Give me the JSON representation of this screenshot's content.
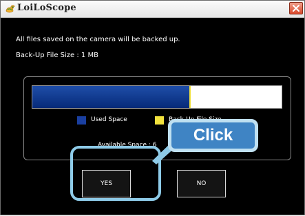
{
  "window": {
    "title": "LoiLoScope",
    "close_icon": "close-icon"
  },
  "dialog": {
    "message": "All files saved on the camera will be backed up.",
    "backup_size": "Back-Up File Size : 1 MB"
  },
  "storage": {
    "used_fraction": 0.63,
    "backup_fraction": 0.006,
    "legend_used": "Used Space",
    "legend_backup": "Back-Up File Size",
    "available": "Available Space : 6",
    "colors": {
      "used": "#1a3fa0",
      "backup": "#f2e23d"
    }
  },
  "buttons": {
    "yes": "YES",
    "no": "NO"
  },
  "annotation": {
    "callout": "Click",
    "color": "#3f84c4"
  }
}
